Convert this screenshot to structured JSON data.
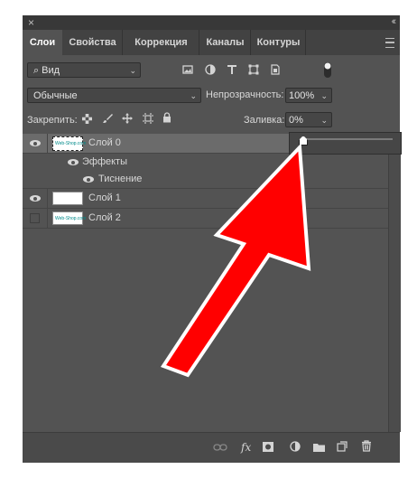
{
  "titlebar": {
    "close": "×",
    "collapse": "‹‹"
  },
  "tabs": [
    "Слои",
    "Свойства",
    "Коррекция",
    "Каналы",
    "Контуры"
  ],
  "filter": {
    "label": "Вид",
    "icon": "⌕"
  },
  "blend": {
    "mode": "Обычные",
    "opacity_label": "Непрозрачность:",
    "opacity_value": "100%"
  },
  "lock": {
    "label": "Закрепить:",
    "fill_label": "Заливка:",
    "fill_value": "0%"
  },
  "layers": {
    "layer0": {
      "name": "Слой 0",
      "thumb_text": "Web-Shop.com"
    },
    "effects": "Эффекты",
    "emboss": "Тиснение",
    "layer1": {
      "name": "Слой 1"
    },
    "layer2": {
      "name": "Слой 2",
      "thumb_text": "Web-Shop.com"
    }
  },
  "fill_slider": {
    "value_percent": 0
  },
  "bottom": {
    "fx": "fx"
  },
  "colors": {
    "panel": "#535353",
    "arrow": "#ff0000",
    "selected_row": "#6b6b6b"
  }
}
